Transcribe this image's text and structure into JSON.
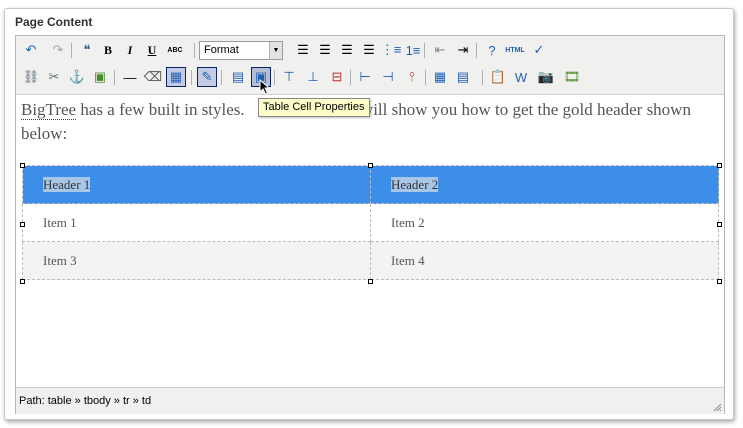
{
  "panel": {
    "title": "Page Content"
  },
  "toolbar": {
    "row1": [
      {
        "name": "undo-icon",
        "glyph": "↶",
        "color": "#1f5fb4"
      },
      {
        "name": "redo-icon",
        "glyph": "↷",
        "color": "#9aa6b6"
      },
      {
        "name": "blockquote-icon",
        "glyph": "❝",
        "color": "#3b5a8a"
      },
      {
        "name": "bold-icon",
        "glyph": "B",
        "color": "#000000"
      },
      {
        "name": "italic-icon",
        "glyph": "I",
        "color": "#000000"
      },
      {
        "name": "underline-icon",
        "glyph": "U",
        "color": "#000000"
      },
      {
        "name": "strikethrough-icon",
        "glyph": "ABC",
        "color": "#000000"
      },
      {
        "name": "align-left-icon",
        "glyph": "☰",
        "color": "#000000"
      },
      {
        "name": "align-center-icon",
        "glyph": "☰",
        "color": "#000000"
      },
      {
        "name": "align-right-icon",
        "glyph": "☰",
        "color": "#000000"
      },
      {
        "name": "align-justify-icon",
        "glyph": "☰",
        "color": "#000000"
      },
      {
        "name": "bullet-list-icon",
        "glyph": "⋮≡",
        "color": "#1f5fb4"
      },
      {
        "name": "numbered-list-icon",
        "glyph": "1≡",
        "color": "#1f5fb4"
      },
      {
        "name": "outdent-icon",
        "glyph": "⇤",
        "color": "#8a8a8a"
      },
      {
        "name": "indent-icon",
        "glyph": "⇥",
        "color": "#000000"
      },
      {
        "name": "help-icon",
        "glyph": "?",
        "color": "#1f5fb4"
      },
      {
        "name": "html-source-icon",
        "glyph": "HTML",
        "color": "#1f5fb4"
      },
      {
        "name": "spellcheck-icon",
        "glyph": "✓",
        "color": "#1f5fb4"
      }
    ],
    "format_select": {
      "value": "Format"
    },
    "row2": [
      {
        "name": "link-icon",
        "glyph": "⛓",
        "color": "#5a6a80"
      },
      {
        "name": "unlink-icon",
        "glyph": "✂",
        "color": "#5a6a80"
      },
      {
        "name": "anchor-icon",
        "glyph": "⚓",
        "color": "#1f5fb4"
      },
      {
        "name": "image-icon",
        "glyph": "▣",
        "color": "#4a8a2a"
      },
      {
        "name": "horizontal-rule-icon",
        "glyph": "—",
        "color": "#000000"
      },
      {
        "name": "remove-format-icon",
        "glyph": "⌫",
        "color": "#555555"
      },
      {
        "name": "table-icon",
        "glyph": "▦",
        "color": "#1f5fb4"
      },
      {
        "name": "table-row-properties-icon",
        "glyph": "✎",
        "color": "#1f5fb4"
      },
      {
        "name": "table-props-icon",
        "glyph": "▤",
        "color": "#1f5fb4"
      },
      {
        "name": "table-cell-properties-icon",
        "glyph": "▣",
        "color": "#1f5fb4"
      },
      {
        "name": "insert-row-before-icon",
        "glyph": "⊤",
        "color": "#1f5fb4"
      },
      {
        "name": "insert-row-after-icon",
        "glyph": "⊥",
        "color": "#1f5fb4"
      },
      {
        "name": "delete-row-icon",
        "glyph": "⊟",
        "color": "#c03030"
      },
      {
        "name": "insert-col-before-icon",
        "glyph": "⊢",
        "color": "#1f5fb4"
      },
      {
        "name": "insert-col-after-icon",
        "glyph": "⊣",
        "color": "#1f5fb4"
      },
      {
        "name": "delete-col-icon",
        "glyph": "⫯",
        "color": "#c03030"
      },
      {
        "name": "split-cells-icon",
        "glyph": "▦",
        "color": "#1f5fb4"
      },
      {
        "name": "merge-cells-icon",
        "glyph": "▤",
        "color": "#1f5fb4"
      },
      {
        "name": "paste-text-icon",
        "glyph": "📋",
        "color": "#8a6a20"
      },
      {
        "name": "paste-word-icon",
        "glyph": "W",
        "color": "#1f5fb4"
      },
      {
        "name": "camera-icon",
        "glyph": "📷",
        "color": "#222222"
      },
      {
        "name": "video-icon",
        "glyph": "🎞",
        "color": "#4a8a2a"
      }
    ]
  },
  "content": {
    "intro_brand": "BigTree",
    "intro_text_a": " has a few built in styles. ",
    "intro_text_b": "will show you how to get the gold header shown below:",
    "table": {
      "header": [
        "Header 1",
        "Header 2"
      ],
      "rows": [
        [
          "Item 1",
          "Item 2"
        ],
        [
          "Item 3",
          "Item 4"
        ]
      ]
    }
  },
  "tooltip": {
    "text": "Table Cell Properties"
  },
  "statusbar": {
    "path": "Path: table » tbody » tr » td"
  },
  "colors": {
    "header_bg": "#3d8ee8",
    "tooltip_bg": "#fdfdc9",
    "toolbar_bg": "#f0f0ee"
  }
}
